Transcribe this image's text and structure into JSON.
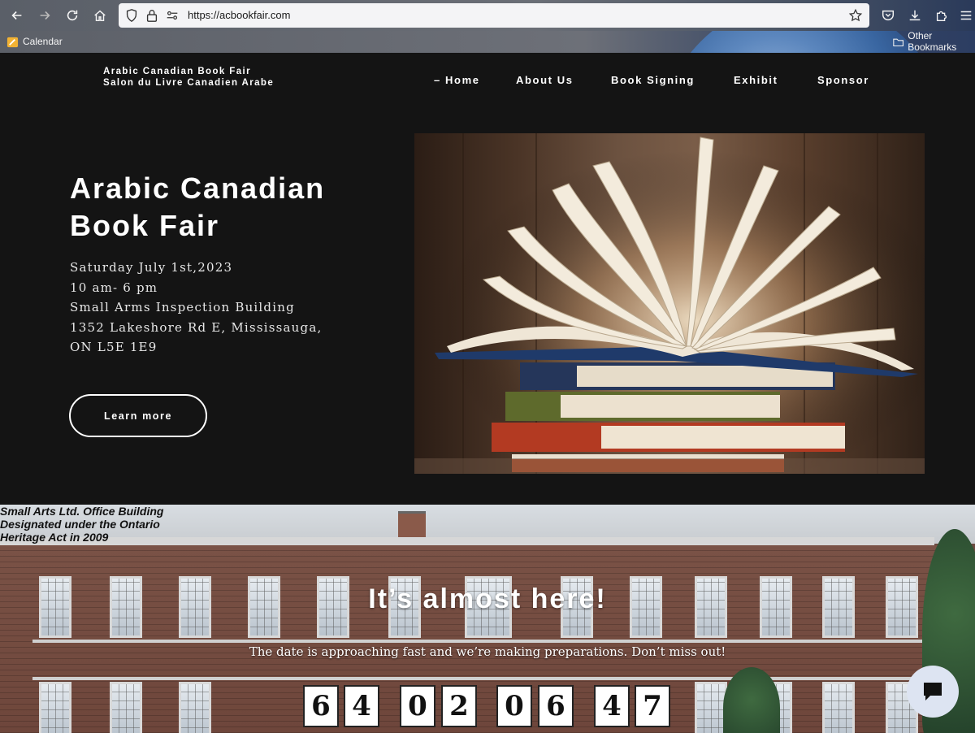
{
  "browser": {
    "url": "https://acbookfair.com",
    "bookmarks": [
      {
        "label": "Calendar",
        "icon": "calendar-icon"
      },
      {
        "label": "Other Bookmarks",
        "icon": "folder-icon"
      }
    ]
  },
  "site": {
    "brand_line1": "Arabic Canadian Book Fair",
    "brand_line2": "Salon du Livre Canadien Arabe",
    "nav": [
      {
        "label": "– Home"
      },
      {
        "label": "About Us"
      },
      {
        "label": "Book Signing"
      },
      {
        "label": "Exhibit"
      },
      {
        "label": "Sponsor"
      }
    ]
  },
  "hero": {
    "title_line1": "Arabic Canadian",
    "title_line2": "Book Fair",
    "details": [
      "Saturday July 1st,2023",
      "10 am- 6 pm",
      "Small Arms Inspection Building",
      "1352 Lakeshore Rd E, Mississauga,",
      "ON L5E 1E9"
    ],
    "button_label": "Learn more"
  },
  "countdown_section": {
    "sign_lines": [
      "Small Arts Ltd. Office Building",
      "Designated under the Ontario",
      "Heritage Act in 2009"
    ],
    "title": "It’s almost here!",
    "subtitle": "The date is approaching fast and we’re making preparations. Don’t miss out!",
    "digits": [
      "6",
      "4",
      "0",
      "2",
      "0",
      "6",
      "4",
      "7"
    ]
  }
}
